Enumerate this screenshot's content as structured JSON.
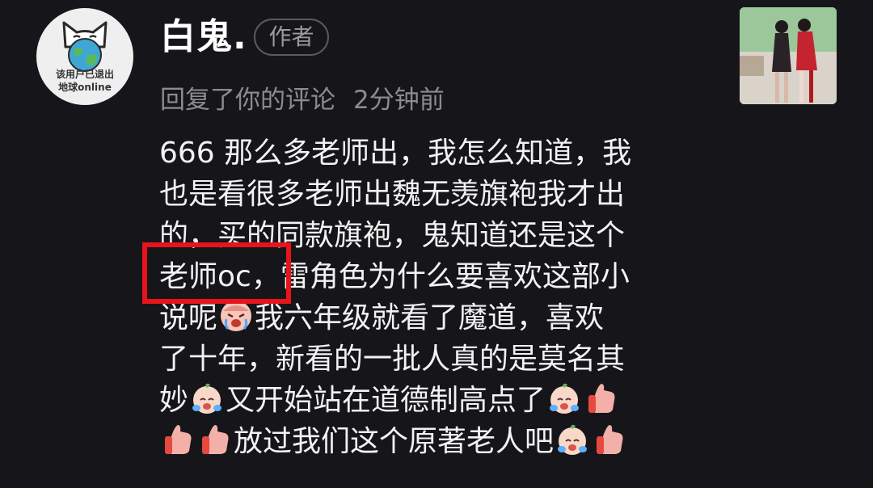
{
  "header": {
    "avatar_caption_line1": "该用户已退出",
    "avatar_caption_line2": "地球online",
    "username": "白鬼.",
    "author_badge": "作者",
    "action": "回复了你的评论",
    "time": "2分钟前"
  },
  "comment": {
    "lines": [
      "666 那么多老师出，我怎么知道，我",
      "也是看很多老师出魏无羡旗袍我才出",
      "的，买的同款旗袍，鬼知道还是这个",
      "老师oc，雷角色为什么要喜欢这部小",
      "说呢",
      "我六年级就看了魔道，喜欢",
      "了十年，新看的一批人真的是莫名其",
      "妙",
      "又开始站在道德制高点了",
      "放过我们这个原著老人吧"
    ],
    "emojis": [
      "crying-face-emoji",
      "crying-face-emoji",
      "crying-face-emoji",
      "thumbs-up-emoji",
      "thumbs-up-emoji",
      "thumbs-up-emoji",
      "crying-face-emoji",
      "thumbs-up-emoji"
    ]
  },
  "colors": {
    "background": "#16161a",
    "text": "#f2f2f2",
    "meta": "#8b8b90",
    "highlight": "#e8141b"
  }
}
